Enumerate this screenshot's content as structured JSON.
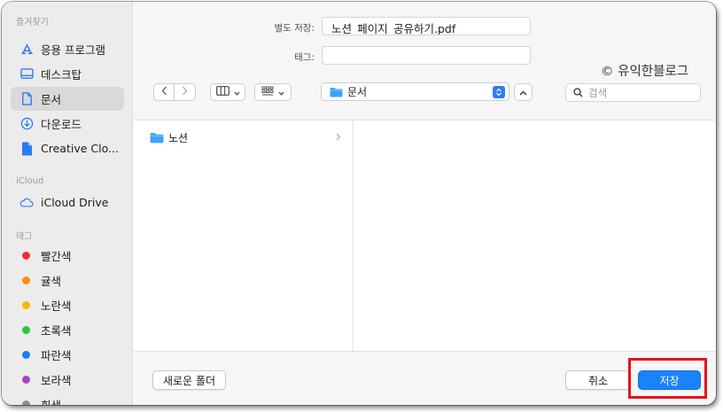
{
  "sidebar": {
    "favorites_header": "즐겨찾기",
    "favorites": [
      {
        "label": "응용 프로그램",
        "icon": "applications-icon"
      },
      {
        "label": "데스크탑",
        "icon": "desktop-icon"
      },
      {
        "label": "문서",
        "icon": "document-icon",
        "selected": true
      },
      {
        "label": "다운로드",
        "icon": "download-icon"
      },
      {
        "label": "Creative Clo...",
        "icon": "file-icon"
      }
    ],
    "icloud_header": "iCloud",
    "icloud": [
      {
        "label": "iCloud Drive",
        "icon": "cloud-icon"
      }
    ],
    "tags_header": "태그",
    "tags": [
      {
        "label": "빨간색",
        "color": "#fe2b2b"
      },
      {
        "label": "귤색",
        "color": "#fd8a16"
      },
      {
        "label": "노란색",
        "color": "#f5b800"
      },
      {
        "label": "초록색",
        "color": "#28c73f"
      },
      {
        "label": "파란색",
        "color": "#1a7cf7"
      },
      {
        "label": "보라색",
        "color": "#a845c9"
      },
      {
        "label": "회색",
        "color": "#8e8e93"
      }
    ]
  },
  "save_as": {
    "label": "별도 저장:",
    "value": "노션_페이지_공유하기.pdf"
  },
  "tags_field": {
    "label": "태그:",
    "value": ""
  },
  "toolbar": {
    "location": "문서",
    "search_placeholder": "검색"
  },
  "watermark": "© 유익한블로그",
  "browser": {
    "items": [
      {
        "label": "노션",
        "icon": "folder-icon"
      }
    ]
  },
  "buttons": {
    "new_folder": "새로운 폴더",
    "cancel": "취소",
    "save": "저장"
  },
  "colors": {
    "accent": "#1a82fb",
    "highlight": "#e0161e",
    "folder": "#3fa2f7"
  }
}
